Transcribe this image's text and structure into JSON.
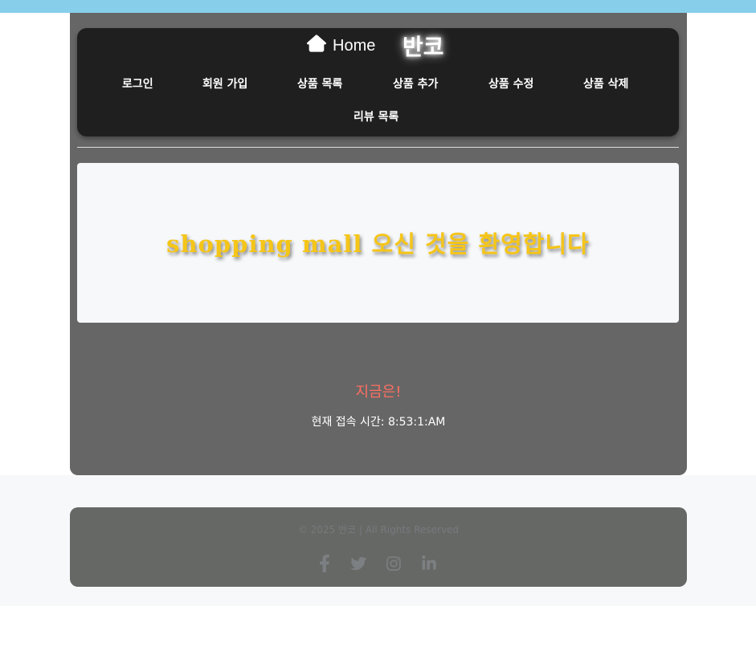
{
  "colors": {
    "topbar": "#87ceeb",
    "panel": "#666666",
    "nav_bg": "#1f1f1f",
    "welcome_text": "#f5c518",
    "now_label": "#ff6f61"
  },
  "header": {
    "home_label": "Home",
    "home_icon": "home-icon",
    "logo": "반코"
  },
  "nav": {
    "items": [
      {
        "label": "로그인"
      },
      {
        "label": "회원 가입"
      },
      {
        "label": "상품 목록"
      },
      {
        "label": "상품 추가"
      },
      {
        "label": "상품 수정"
      },
      {
        "label": "상품 삭제"
      },
      {
        "label": "리뷰 목록"
      }
    ]
  },
  "main": {
    "welcome": "shopping mall 오신 것을 환영합니다",
    "now_label": "지금은!",
    "access_time_label": "현재 접속 시간: 8:53:1:AM"
  },
  "footer": {
    "copyright": "© 2025 반코 | All Rights Reserved",
    "social_icons": [
      "facebook-icon",
      "twitter-icon",
      "instagram-icon",
      "linkedin-icon"
    ]
  }
}
